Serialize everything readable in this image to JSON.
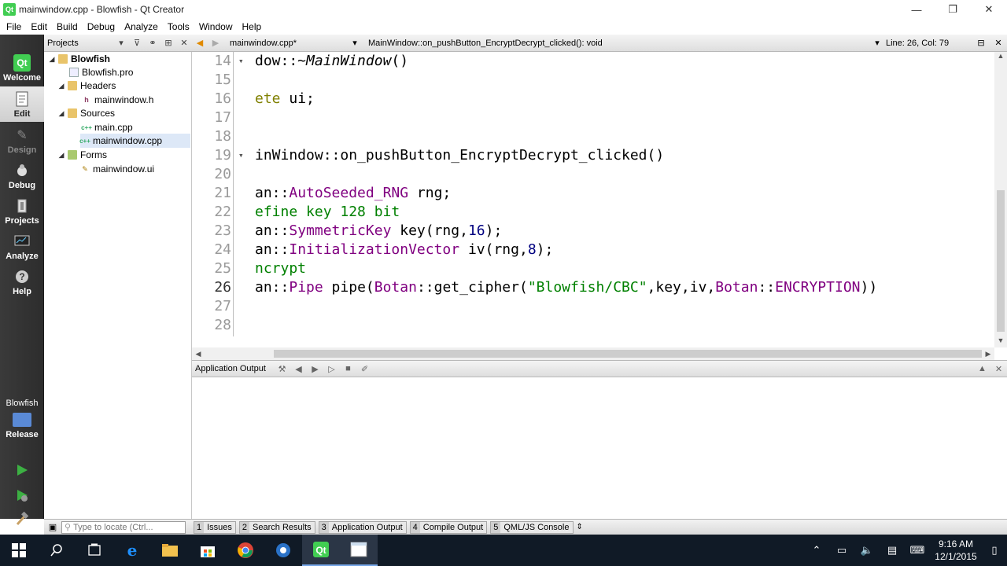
{
  "window": {
    "title": "mainwindow.cpp - Blowfish - Qt Creator",
    "app_icon": "Qt",
    "controls": [
      "—",
      "❐",
      "✕"
    ]
  },
  "menu": [
    "File",
    "Edit",
    "Build",
    "Debug",
    "Analyze",
    "Tools",
    "Window",
    "Help"
  ],
  "modes": [
    {
      "label": "Welcome",
      "icon": "qt-logo-icon",
      "state": "normal"
    },
    {
      "label": "Edit",
      "icon": "edit-document-icon",
      "state": "active"
    },
    {
      "label": "Design",
      "icon": "design-pen-icon",
      "state": "disabled"
    },
    {
      "label": "Debug",
      "icon": "bug-icon",
      "state": "normal"
    },
    {
      "label": "Projects",
      "icon": "wrench-icon",
      "state": "normal"
    },
    {
      "label": "Analyze",
      "icon": "monitor-icon",
      "state": "normal"
    },
    {
      "label": "Help",
      "icon": "question-icon",
      "state": "normal"
    }
  ],
  "kit": {
    "project": "Blowfish",
    "config": "Release"
  },
  "projects_pane": {
    "selector": "Projects",
    "tree": [
      {
        "label": "Blowfish",
        "level": 0,
        "type": "project",
        "expanded": true
      },
      {
        "label": "Blowfish.pro",
        "level": 1,
        "type": "pro"
      },
      {
        "label": "Headers",
        "level": 1,
        "type": "folder",
        "expanded": true
      },
      {
        "label": "mainwindow.h",
        "level": 2,
        "type": "h"
      },
      {
        "label": "Sources",
        "level": 1,
        "type": "folder",
        "expanded": true
      },
      {
        "label": "main.cpp",
        "level": 2,
        "type": "cpp"
      },
      {
        "label": "mainwindow.cpp",
        "level": 2,
        "type": "cpp",
        "selected": true
      },
      {
        "label": "Forms",
        "level": 1,
        "type": "folder",
        "expanded": true
      },
      {
        "label": "mainwindow.ui",
        "level": 2,
        "type": "ui"
      }
    ]
  },
  "editor_header": {
    "document": "mainwindow.cpp*",
    "symbol": "MainWindow::on_pushButton_EncryptDecrypt_clicked(): void",
    "position": "Line: 26, Col: 79"
  },
  "code": {
    "current_line": 26,
    "lines": [
      {
        "n": "14",
        "fold": true,
        "segs": [
          [
            "dow::~",
            ""
          ],
          [
            "MainWindow",
            "it"
          ],
          [
            "()",
            ""
          ]
        ]
      },
      {
        "n": "15",
        "fold": false,
        "segs": []
      },
      {
        "n": "16",
        "fold": false,
        "segs": [
          [
            "ete ",
            "kw"
          ],
          [
            "ui",
            ""
          ],
          [
            ";",
            ""
          ]
        ]
      },
      {
        "n": "17",
        "fold": false,
        "segs": []
      },
      {
        "n": "18",
        "fold": false,
        "segs": []
      },
      {
        "n": "19",
        "fold": true,
        "segs": [
          [
            "inWindow::on_pushButton_EncryptDecrypt_clicked()",
            ""
          ]
        ]
      },
      {
        "n": "20",
        "fold": false,
        "segs": []
      },
      {
        "n": "21",
        "fold": false,
        "segs": [
          [
            "an::",
            ""
          ],
          [
            "AutoSeeded_RNG",
            "ty"
          ],
          [
            " rng;",
            ""
          ]
        ]
      },
      {
        "n": "22",
        "fold": false,
        "segs": [
          [
            "efine key 128 bit",
            "cmt"
          ]
        ]
      },
      {
        "n": "23",
        "fold": false,
        "segs": [
          [
            "an::",
            ""
          ],
          [
            "SymmetricKey",
            "ty"
          ],
          [
            " key(rng,",
            ""
          ],
          [
            "16",
            "num"
          ],
          [
            ");",
            ""
          ]
        ]
      },
      {
        "n": "24",
        "fold": false,
        "segs": [
          [
            "an::",
            ""
          ],
          [
            "InitializationVector",
            "ty"
          ],
          [
            " iv(rng,",
            ""
          ],
          [
            "8",
            "num"
          ],
          [
            ");",
            ""
          ]
        ]
      },
      {
        "n": "25",
        "fold": false,
        "segs": [
          [
            "ncrypt",
            "cmt"
          ]
        ]
      },
      {
        "n": "26",
        "fold": false,
        "segs": [
          [
            "an::",
            ""
          ],
          [
            "Pipe",
            "ty"
          ],
          [
            " pipe(",
            ""
          ],
          [
            "Botan",
            "ty"
          ],
          [
            "::get_cipher(",
            ""
          ],
          [
            "\"Blowfish/CBC\"",
            "str"
          ],
          [
            ",key,iv,",
            ""
          ],
          [
            "Botan",
            "ty"
          ],
          [
            "::",
            ""
          ],
          [
            "ENCRYPTION",
            "ty"
          ],
          [
            "))",
            ""
          ]
        ]
      },
      {
        "n": "27",
        "fold": false,
        "segs": []
      },
      {
        "n": "28",
        "fold": false,
        "segs": []
      }
    ]
  },
  "output_pane": {
    "title": "Application Output"
  },
  "statusbar": {
    "locator_placeholder": "Type to locate (Ctrl...",
    "tabs": [
      {
        "num": "1",
        "label": "Issues"
      },
      {
        "num": "2",
        "label": "Search Results"
      },
      {
        "num": "3",
        "label": "Application Output"
      },
      {
        "num": "4",
        "label": "Compile Output"
      },
      {
        "num": "5",
        "label": "QML/JS Console"
      }
    ]
  },
  "taskbar": {
    "apps": [
      "windows-start-icon",
      "search-icon",
      "task-view-icon",
      "edge-icon",
      "file-explorer-icon",
      "store-icon",
      "chrome-icon",
      "outlook-icon",
      "qt-creator-icon",
      "app-window-icon"
    ],
    "time": "9:16 AM",
    "date": "12/1/2015"
  }
}
